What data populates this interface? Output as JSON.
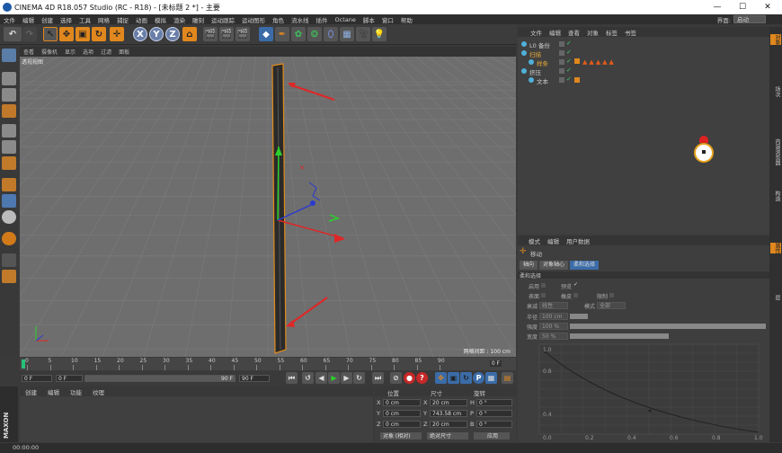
{
  "app": {
    "title": "CINEMA 4D R18.057 Studio (RC - R18) - [未标题 2 *] - 主要",
    "layout_label": "界面:",
    "layout_value": "启动"
  },
  "window_controls": {
    "minimize": "—",
    "maximize": "☐",
    "close": "✕"
  },
  "menubar": [
    "文件",
    "编辑",
    "创建",
    "选择",
    "工具",
    "网格",
    "捕捉",
    "动画",
    "模拟",
    "渲染",
    "雕刻",
    "运动跟踪",
    "运动图形",
    "角色",
    "流水线",
    "插件",
    "Octane",
    "脚本",
    "窗口",
    "帮助"
  ],
  "toolbar": {
    "axis_x": "X",
    "axis_y": "Y",
    "axis_z": "Z"
  },
  "viewport": {
    "menu": [
      "查看",
      "摄像机",
      "显示",
      "选项",
      "过滤",
      "面板"
    ],
    "label": "透视视图",
    "grid_spacing": "网格间距 : 100 cm",
    "colors": {
      "bg": "#6e6e6e",
      "grid": "#7c7c7c",
      "arrow": "#e02626"
    }
  },
  "timeline": {
    "ticks": [
      "0",
      "5",
      "10",
      "15",
      "20",
      "25",
      "30",
      "35",
      "40",
      "45",
      "50",
      "55",
      "60",
      "65",
      "70",
      "75",
      "80",
      "85",
      "90"
    ],
    "frame_indicator": "0 F"
  },
  "controls": {
    "current_frame": "0 F",
    "start_frame": "0 F",
    "end_frame_slider": "90 F",
    "end_frame": "90 F"
  },
  "material": {
    "menu": [
      "创建",
      "编辑",
      "功能",
      "纹理"
    ]
  },
  "coordinates": {
    "headers": [
      "位置",
      "尺寸",
      "旋转"
    ],
    "rows": [
      {
        "axis": "X",
        "pos": "0 cm",
        "size": "20 cm",
        "rot_axis": "H",
        "rot": "0 °"
      },
      {
        "axis": "Y",
        "pos": "0 cm",
        "size": "743.58 cm",
        "rot_axis": "P",
        "rot": "0 °"
      },
      {
        "axis": "Z",
        "pos": "0 cm",
        "size": "20 cm",
        "rot_axis": "B",
        "rot": "0 °"
      }
    ],
    "mode": "对象 (相对)",
    "size_mode": "绝对尺寸",
    "apply": "应用"
  },
  "status": {
    "time": "00:00:00"
  },
  "objects": {
    "menu": [
      "文件",
      "编辑",
      "查看",
      "对象",
      "标签",
      "书签"
    ],
    "items": [
      {
        "name": "L0 备份",
        "color": "#cccccc",
        "indent": 0
      },
      {
        "name": "扫描",
        "color": "#e0a63a",
        "indent": 0
      },
      {
        "name": "样条",
        "color": "#e0a63a",
        "indent": 1
      },
      {
        "name": "挤压",
        "color": "#cccccc",
        "indent": 0
      },
      {
        "name": "文本",
        "color": "#cccccc",
        "indent": 1
      }
    ]
  },
  "attributes": {
    "menu": [
      "模式",
      "编辑",
      "用户数据"
    ],
    "tool_name": "移动",
    "tabs": [
      "轴向",
      "对象轴心",
      "柔和选择"
    ],
    "section": "柔和选择",
    "options": [
      {
        "label": "启用",
        "label2": "预览"
      },
      {
        "label": "表面",
        "label2": "橡皮",
        "label3": "限制"
      }
    ],
    "mode_label": "衰减",
    "mode_value": "线性",
    "shape_label": "模式",
    "shape_value": "全部",
    "radius_label": "半径",
    "radius_value": "100 cm",
    "strength_label": "强度",
    "strength_value": "100 %",
    "width_label": "宽度",
    "width_value": "50 %",
    "graph_y": [
      "1.0",
      "0.8",
      "0.4"
    ],
    "graph_x": [
      "0.0",
      "0.2",
      "0.4",
      "0.6",
      "0.8",
      "1.0"
    ]
  },
  "sidetabs": [
    "对象",
    "场次",
    "内容浏览器",
    "构造",
    "属性",
    "层"
  ]
}
